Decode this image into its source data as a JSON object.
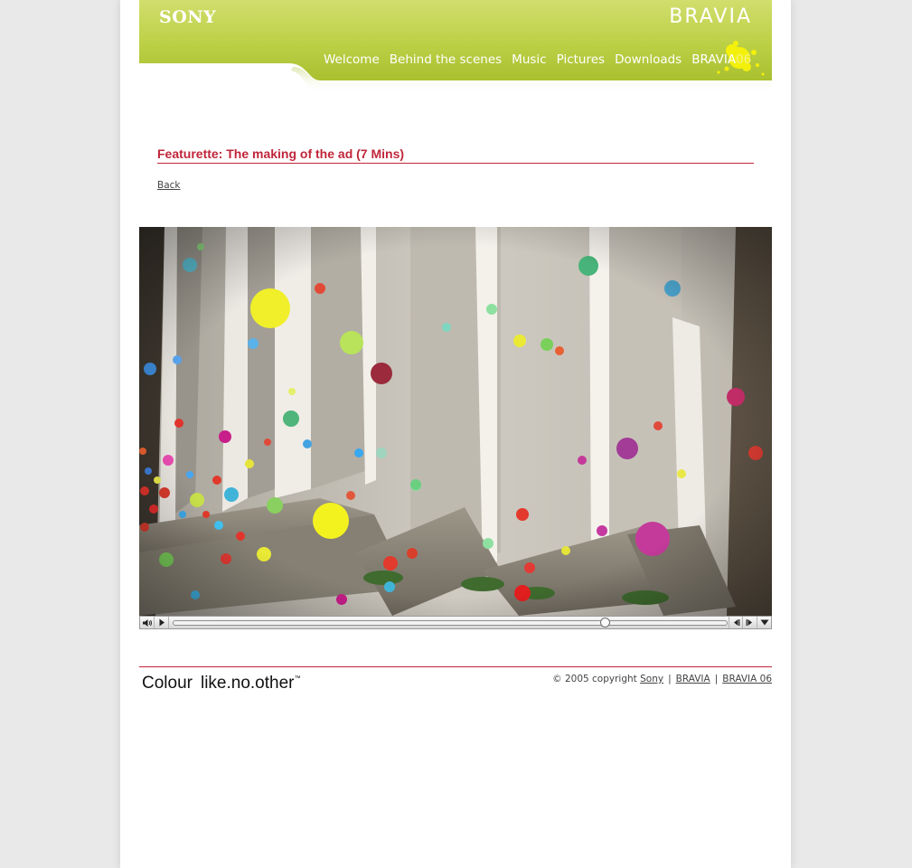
{
  "header": {
    "brand_left": "SONY",
    "brand_right": "BRAVIA",
    "nav": [
      {
        "label": "Welcome"
      },
      {
        "label": "Behind the scenes"
      },
      {
        "label": "Music"
      },
      {
        "label": "Pictures"
      },
      {
        "label": "Downloads"
      },
      {
        "label": "BRAVIA",
        "suffix": "06"
      }
    ]
  },
  "content": {
    "title": "Featurette: The making of the ad (7 Mins)",
    "back_label": "Back"
  },
  "player": {
    "progress": 0.78,
    "controls": [
      "volume-icon",
      "play-icon",
      "step-back-icon",
      "step-forward-icon",
      "menu-arrow-icon"
    ]
  },
  "footer": {
    "tagline_word": "Colour",
    "tagline_slogan": "like.no.other",
    "tagline_mark": "™",
    "copyright_prefix": "© 2005 copyright",
    "links": [
      "Sony",
      "BRAVIA",
      "BRAVIA 06"
    ],
    "separator": "|"
  },
  "colors": {
    "accent": "#c0263a",
    "header_green": "#b6cb3e",
    "page_bg": "#e9e9e9"
  }
}
